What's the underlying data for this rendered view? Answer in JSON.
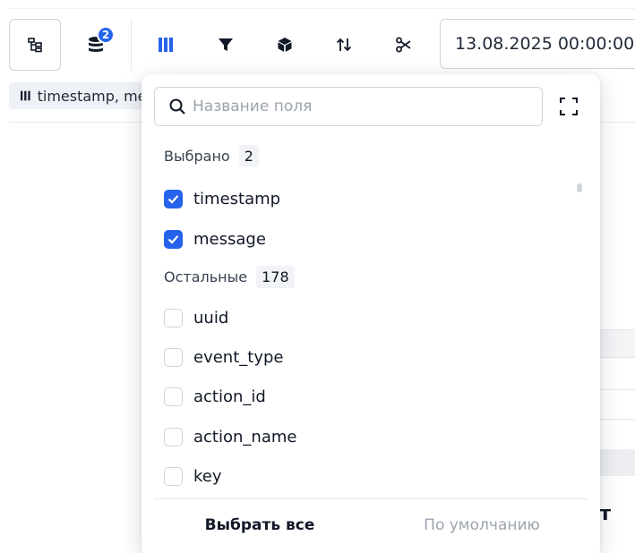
{
  "toolbar": {
    "badge_count": "2",
    "date_value": "13.08.2025 00:00:00",
    "icons": [
      "tree-icon",
      "database-icon",
      "columns-icon",
      "filter-icon",
      "cube-icon",
      "sort-icon",
      "scissors-icon"
    ]
  },
  "chip": {
    "text": "timestamp, message"
  },
  "background": {
    "partial_text": "ут"
  },
  "popup": {
    "search_placeholder": "Название поля",
    "selected_label": "Выбрано",
    "selected_count": "2",
    "selected_items": [
      {
        "label": "timestamp",
        "checked": true
      },
      {
        "label": "message",
        "checked": true
      }
    ],
    "others_label": "Остальные",
    "others_count": "178",
    "other_items": [
      {
        "label": "uuid",
        "checked": false
      },
      {
        "label": "event_type",
        "checked": false
      },
      {
        "label": "action_id",
        "checked": false
      },
      {
        "label": "action_name",
        "checked": false
      },
      {
        "label": "key",
        "checked": false
      }
    ],
    "select_all_label": "Выбрать все",
    "default_label": "По умолчанию"
  },
  "colors": {
    "accent": "#2563eb",
    "text": "#111827",
    "muted": "#9ca3af",
    "border": "#cfd5dd"
  }
}
